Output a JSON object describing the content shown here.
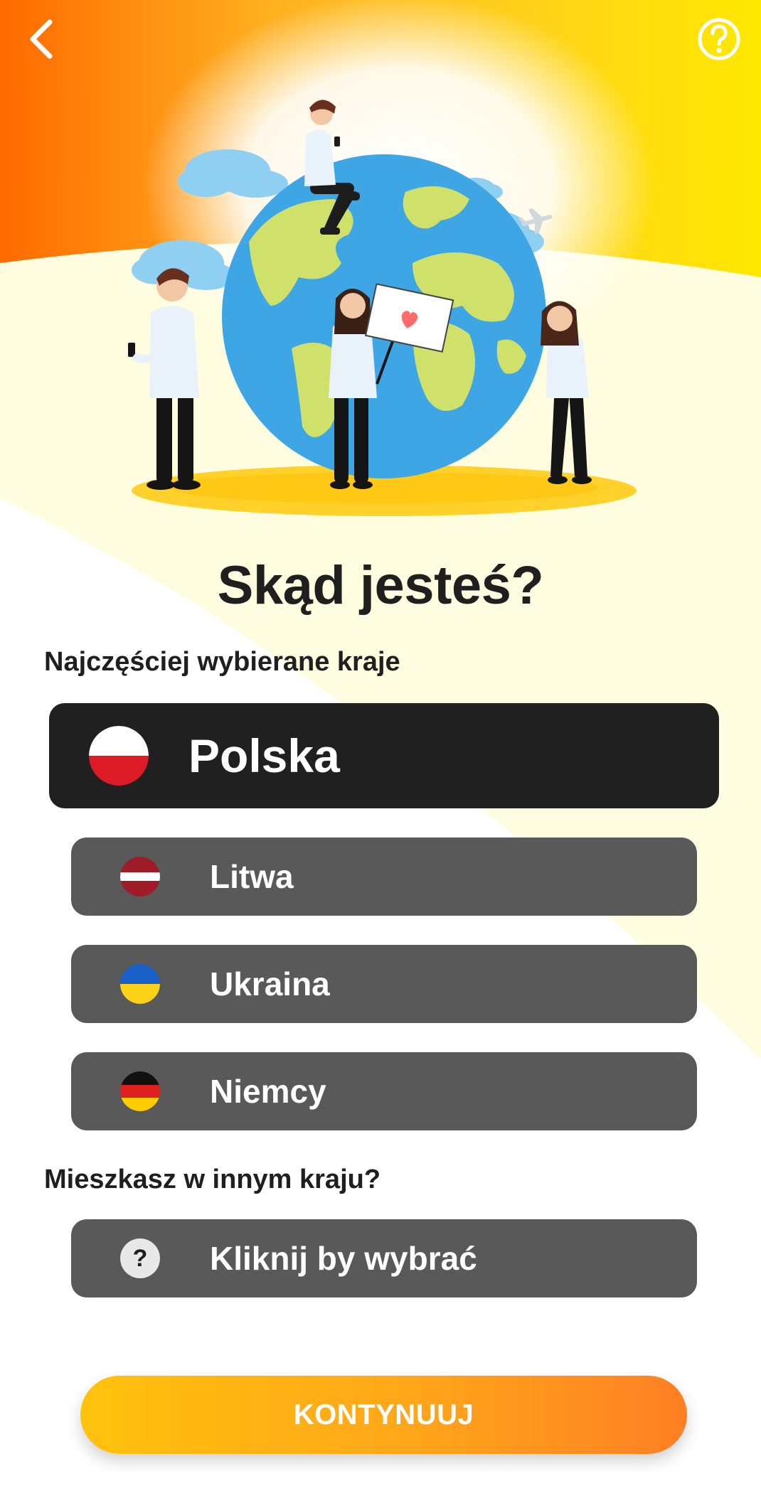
{
  "header": {
    "back_icon": "chevron-left-icon",
    "help_icon": "question-circle-icon"
  },
  "hero": {
    "illustration": "globe-with-people-illustration"
  },
  "title": "Skąd jesteś?",
  "popular_label": "Najczęściej wybierane kraje",
  "countries": [
    {
      "label": "Polska",
      "flag": "poland-flag-icon",
      "selected": true
    },
    {
      "label": "Litwa",
      "flag": "latvia-flag-icon",
      "selected": false
    },
    {
      "label": "Ukraina",
      "flag": "ukraine-flag-icon",
      "selected": false
    },
    {
      "label": "Niemcy",
      "flag": "germany-flag-icon",
      "selected": false
    }
  ],
  "other_label": "Mieszkasz w innym kraju?",
  "other_button": {
    "label": "Kliknij by wybrać",
    "icon": "question-icon",
    "icon_glyph": "?"
  },
  "continue_label": "KONTYNUUJ",
  "colors": {
    "accent_start": "#ffc20d",
    "accent_end": "#ff7f24",
    "selected_bg": "#202020",
    "unselected_bg": "#595959",
    "text_dark": "#1f1f1f"
  }
}
